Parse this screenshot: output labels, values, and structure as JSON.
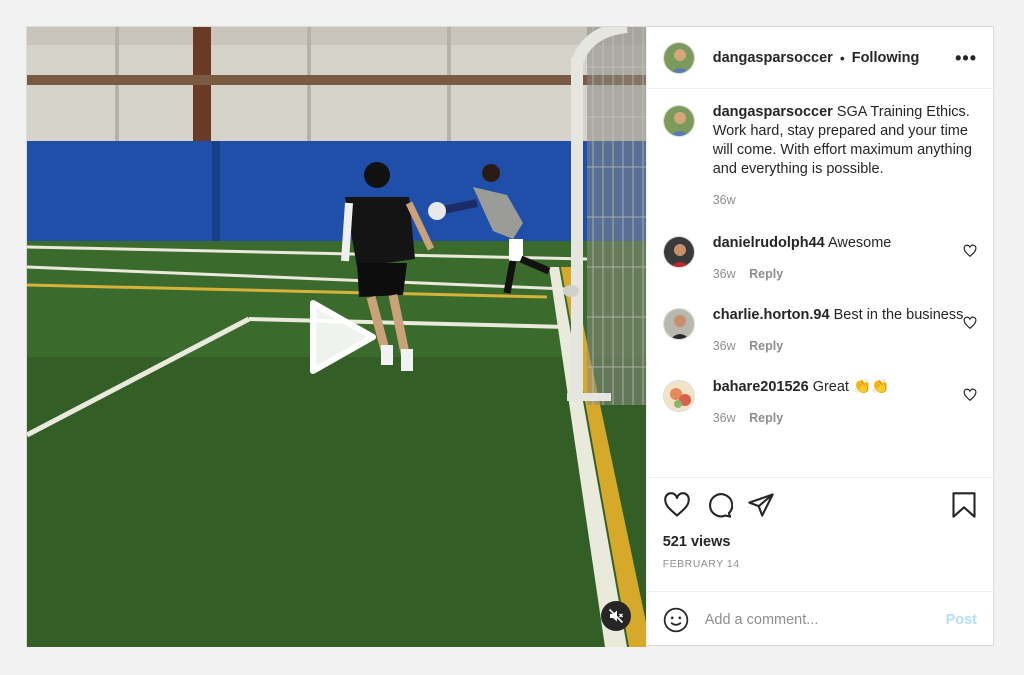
{
  "post": {
    "username": "dangasparsoccer",
    "follow_separator": "•",
    "follow_status": "Following",
    "more_label": "•••",
    "caption": "SGA Training Ethics. Work hard, stay prepared and your time will come. With effort maximum anything and everything is possible.",
    "caption_time": "36w"
  },
  "comments": [
    {
      "username": "danielrudolph44",
      "text": "Awesome",
      "time": "36w",
      "reply": "Reply"
    },
    {
      "username": "charlie.horton.94",
      "text": "Best in the business",
      "time": "36w",
      "reply": "Reply"
    },
    {
      "username": "bahare201526",
      "text": "Great 👏👏",
      "time": "36w",
      "reply": "Reply"
    }
  ],
  "stats": {
    "views": "521 views",
    "date": "FEBRUARY 14"
  },
  "add_comment": {
    "placeholder": "Add a comment...",
    "post_label": "Post"
  },
  "icons": {
    "like": "heart-icon",
    "comment": "comment-icon",
    "share": "share-icon",
    "save": "bookmark-icon",
    "emoji": "emoji-icon",
    "play": "play-icon",
    "mute": "mute-icon"
  },
  "colors": {
    "post_button_disabled": "#b2dffc",
    "muted_text": "#8e8e8e",
    "border": "#dbdbdb"
  }
}
